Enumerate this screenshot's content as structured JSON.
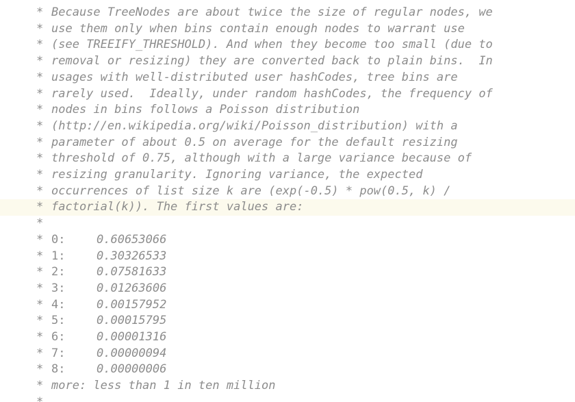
{
  "editor": {
    "prose_lines": [
      "Because TreeNodes are about twice the size of regular nodes, we",
      "use them only when bins contain enough nodes to warrant use",
      "(see TREEIFY_THRESHOLD). And when they become too small (due to",
      "removal or resizing) they are converted back to plain bins.  In",
      "usages with well-distributed user hashCodes, tree bins are",
      "rarely used.  Ideally, under random hashCodes, the frequency of",
      "nodes in bins follows a Poisson distribution",
      "(http://en.wikipedia.org/wiki/Poisson_distribution) with a",
      "parameter of about 0.5 on average for the default resizing",
      "threshold of 0.75, although with a large variance because of",
      "resizing granularity. Ignoring variance, the expected",
      "occurrences of list size k are (exp(-0.5) * pow(0.5, k) /",
      "factorial(k)). The first values are:"
    ],
    "values": [
      {
        "k": "0:",
        "v": "0.60653066"
      },
      {
        "k": "1:",
        "v": "0.30326533"
      },
      {
        "k": "2:",
        "v": "0.07581633"
      },
      {
        "k": "3:",
        "v": "0.01263606"
      },
      {
        "k": "4:",
        "v": "0.00157952"
      },
      {
        "k": "5:",
        "v": "0.00015795"
      },
      {
        "k": "6:",
        "v": "0.00001316"
      },
      {
        "k": "7:",
        "v": "0.00000094"
      },
      {
        "k": "8:",
        "v": "0.00000006"
      }
    ],
    "more_line": "more: less than 1 in ten million",
    "star": "*",
    "highlight_color": "#fcfaed",
    "text_color": "#8c8c8c"
  }
}
